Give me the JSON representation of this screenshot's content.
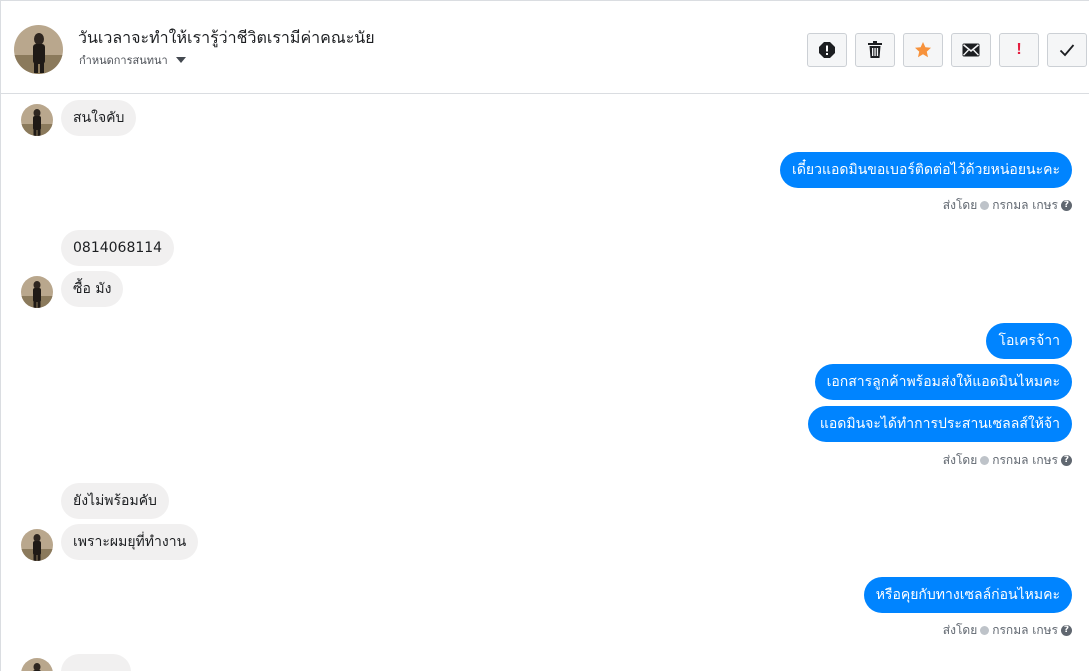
{
  "header": {
    "title": "วันเวลาจะทำให้เรารู้ว่าชีวิตเรามีค่าคณะนัย",
    "subtitle": "กำหนดการสนทนา",
    "actions": [
      {
        "name": "report-icon"
      },
      {
        "name": "trash-icon"
      },
      {
        "name": "star-icon",
        "color": "#f7923b"
      },
      {
        "name": "mail-icon"
      },
      {
        "name": "exclamation-icon",
        "label": "!",
        "color": "#e41e3f"
      },
      {
        "name": "check-icon"
      }
    ]
  },
  "thread": {
    "m1": "สนใจคับ",
    "m2": "เดี๋ยวแอดมินขอเบอร์ติดต่อไว้ด้วยหน่อยนะคะ",
    "s1": {
      "prefix": "ส่งโดย",
      "name": "กรกมล เกษร"
    },
    "m3": "0814068114",
    "m4": "ซื้อ มัง",
    "m5": "โอเครจ้าา",
    "m6": "เอกสารลูกค้าพร้อมส่งให้แอดมินไหมคะ",
    "m7": "แอดมินจะได้ทำการประสานเซลลส์ให้จ้า",
    "s2": {
      "prefix": "ส่งโดย",
      "name": "กรกมล เกษร"
    },
    "m8": "ยังไม่พร้อมคับ",
    "m9": "เพราะผมยุที่ทำงาน",
    "m10": "หรือคุยกับทางเซลล์ก่อนไหมคะ",
    "s3": {
      "prefix": "ส่งโดย",
      "name": "กรกมล เกษร"
    },
    "bubble_in_color": "#f1f0f0",
    "bubble_out_color": "#0084ff"
  }
}
